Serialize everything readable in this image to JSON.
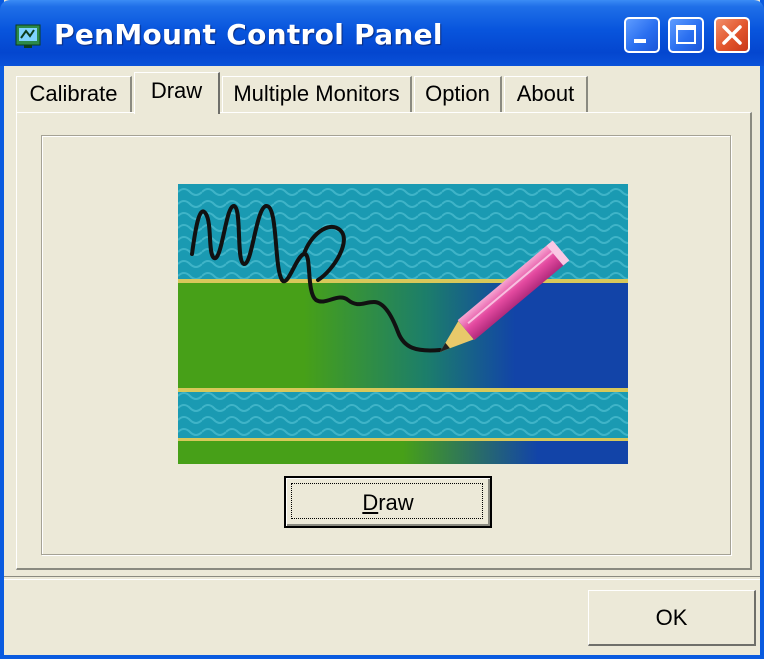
{
  "window": {
    "title": "PenMount Control Panel"
  },
  "tabs": [
    {
      "label": "Calibrate",
      "active": false
    },
    {
      "label": "Draw",
      "active": true
    },
    {
      "label": "Multiple Monitors",
      "active": false
    },
    {
      "label": "Option",
      "active": false
    },
    {
      "label": "About",
      "active": false
    }
  ],
  "draw_panel": {
    "draw_button": {
      "mnemonic": "D",
      "rest": "raw"
    }
  },
  "footer": {
    "ok_label": "OK"
  },
  "colors": {
    "title_bar": "#0855dd",
    "dialog_face": "#ece9d8",
    "close_button": "#e2552c",
    "art_teal": "#1a9ab2",
    "art_green": "#47a018",
    "art_blue": "#1244a8",
    "pencil_pink": "#e44aa0"
  },
  "icons": [
    "penmount-app-icon",
    "minimize-icon",
    "maximize-icon",
    "close-icon",
    "pencil-drawing-illustration"
  ]
}
